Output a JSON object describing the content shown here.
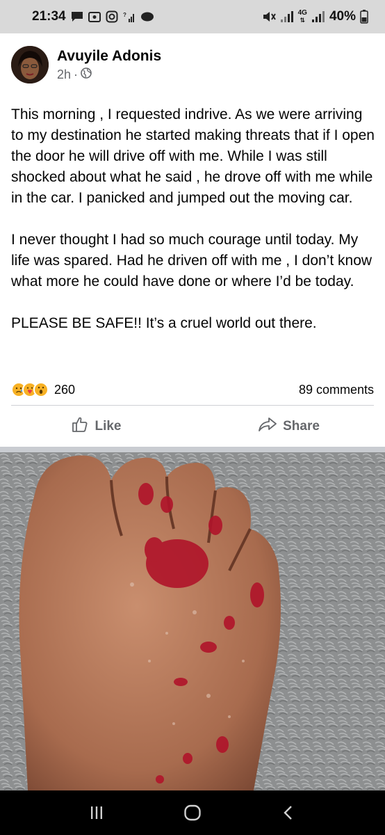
{
  "status_bar": {
    "time": "21:34",
    "battery": "40%",
    "network": "4G",
    "left_icons": [
      "message-icon",
      "vpn-icon",
      "instagram-icon",
      "call-signal-icon",
      "chat-bubble-icon"
    ],
    "right_icons": [
      "mute-icon",
      "signal-icon",
      "data-signal-icon",
      "battery-icon"
    ]
  },
  "post": {
    "author": "Avuyile Adonis",
    "time": "2h",
    "separator": "·",
    "privacy_icon": "globe-icon",
    "paragraphs": [
      "This morning , I requested indrive. As we were arriving to my destination he started making threats that if I open the door he will drive off with me. While I was still shocked about what he said , he drove off with me while in the car. I panicked and jumped out the moving car.",
      "I never thought I had so much courage until today. My life was spared. Had he driven off with me , I don’t know what more he could have done or where I’d be today.",
      "PLEASE BE SAFE!! It’s a cruel world out there."
    ],
    "reactions": {
      "icons": [
        "sad-reaction-icon",
        "care-reaction-icon",
        "wow-reaction-icon"
      ],
      "count": "260"
    },
    "comments": "89 comments",
    "actions": {
      "like": "Like",
      "share": "Share"
    }
  },
  "colors": {
    "status_bar_bg": "#d9d9d9",
    "secondary_text": "#65676b",
    "reaction_yellow": "#f7b125",
    "nav_bar_bg": "#000000"
  },
  "nav_bar": {
    "buttons": [
      "recent-apps-icon",
      "home-icon",
      "back-icon"
    ]
  }
}
